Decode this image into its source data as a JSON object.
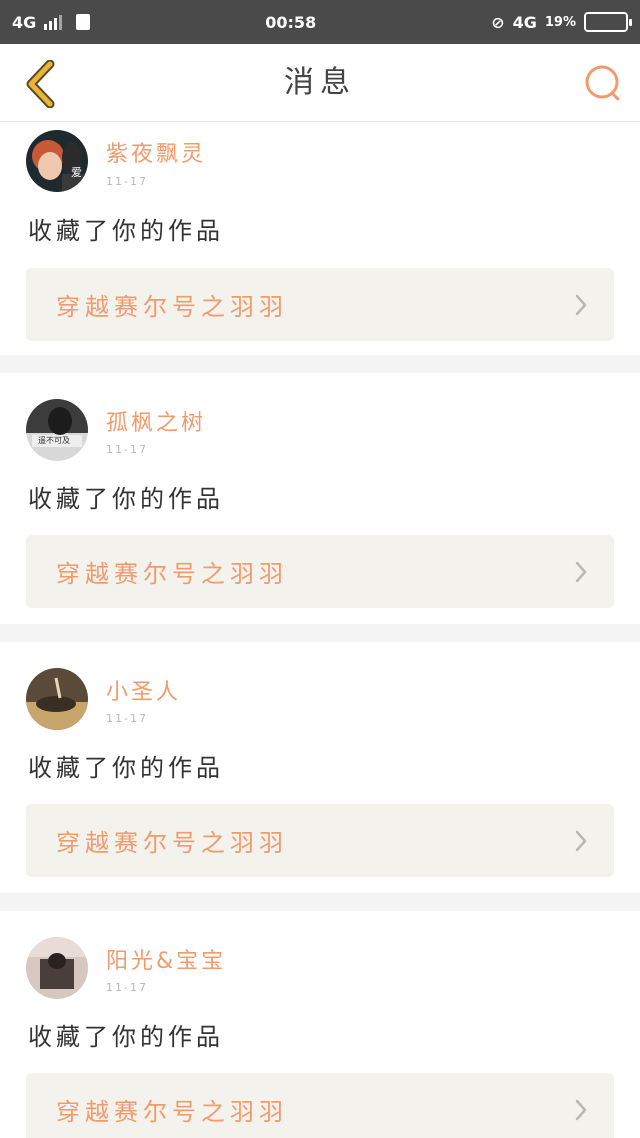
{
  "status_bar": {
    "network_left": "4G",
    "time": "00:58",
    "network_right": "4G",
    "battery": "19%",
    "battery_fraction": 0.19
  },
  "header": {
    "title": "消息",
    "back_icon": "chevron-left-icon",
    "search_icon": "search-icon"
  },
  "colors": {
    "accent": "#f19b6c",
    "back_icon": "#e8b53a",
    "status_bar_bg": "#4a4a4a",
    "card_link_bg": "#f3f2ed"
  },
  "messages": [
    {
      "username": "紫夜飘灵",
      "date": "11-17",
      "action": "收藏了你的作品",
      "work_title": "穿越赛尔号之羽羽",
      "avatar_badge": "爱"
    },
    {
      "username": "孤枫之树",
      "date": "11-17",
      "action": "收藏了你的作品",
      "work_title": "穿越赛尔号之羽羽",
      "avatar_badge": "遥不可及"
    },
    {
      "username": "小圣人",
      "date": "11-17",
      "action": "收藏了你的作品",
      "work_title": "穿越赛尔号之羽羽"
    },
    {
      "username": "阳光&宝宝",
      "date": "11-17",
      "action": "收藏了你的作品",
      "work_title": "穿越赛尔号之羽羽"
    }
  ]
}
